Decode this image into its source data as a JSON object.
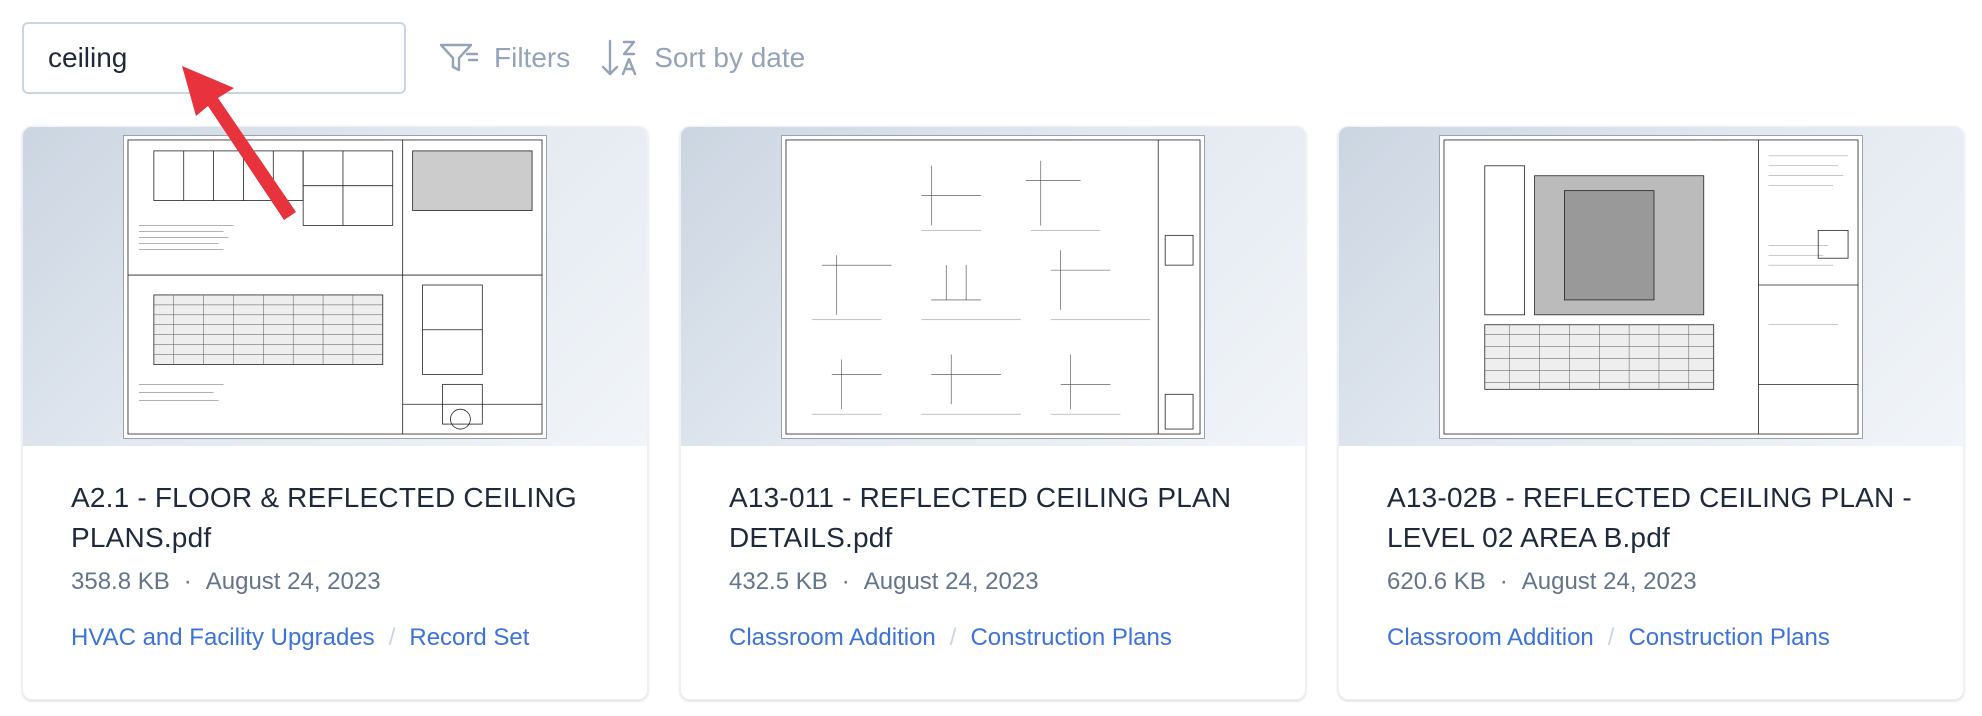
{
  "search": {
    "value": "ceiling"
  },
  "toolbar": {
    "filters_label": "Filters",
    "sort_label": "Sort by date",
    "filter_icon": "filter-icon",
    "sort_icon": "sort-z-a-icon"
  },
  "colors": {
    "link": "#3b73d9",
    "muted": "#64748b",
    "pointer": "#e8323c"
  },
  "cards": [
    {
      "title": "A2.1 - FLOOR & REFLECTED CEILING PLANS.pdf",
      "size": "358.8 KB",
      "date": "August 24, 2023",
      "project": "HVAC and Facility Upgrades",
      "set": "Record Set"
    },
    {
      "title": "A13-011 - REFLECTED CEILING PLAN DETAILS.pdf",
      "size": "432.5 KB",
      "date": "August 24, 2023",
      "project": "Classroom Addition",
      "set": "Construction Plans"
    },
    {
      "title": "A13-02B - REFLECTED CEILING PLAN - LEVEL 02 AREA B.pdf",
      "size": "620.6 KB",
      "date": "August 24, 2023",
      "project": "Classroom Addition",
      "set": "Construction Plans"
    }
  ],
  "meta_separator": "·",
  "crumb_separator": "/"
}
